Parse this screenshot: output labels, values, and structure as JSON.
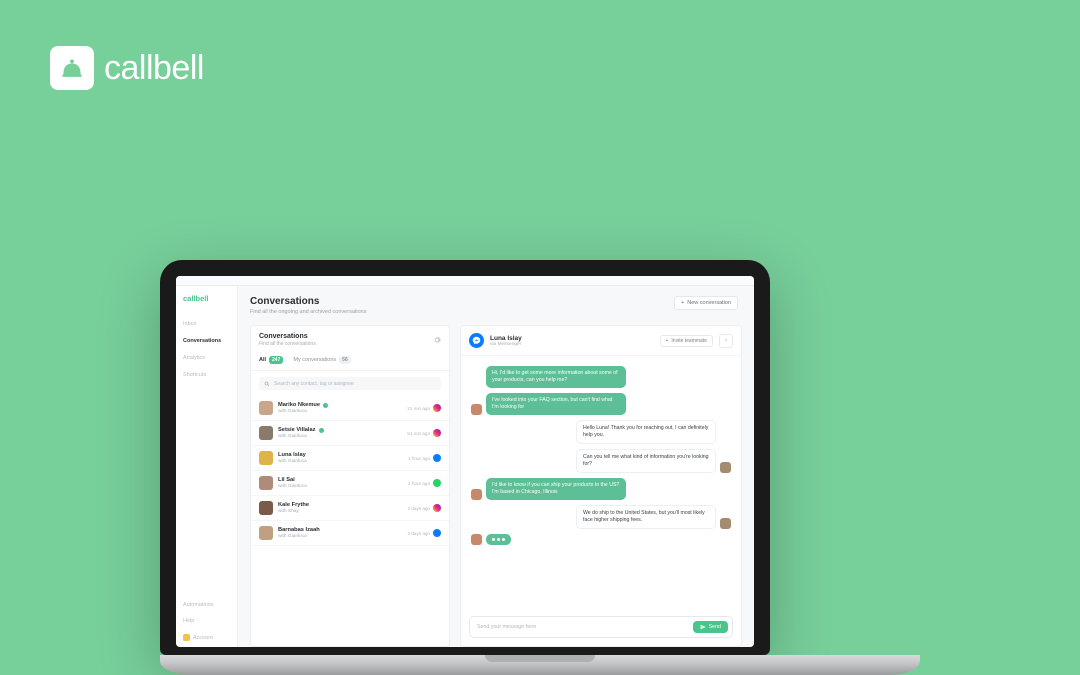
{
  "brand": "callbell",
  "nav": {
    "logo": "callbell",
    "items": [
      "Inbox",
      "Conversations",
      "Analytics",
      "Shortcuts"
    ],
    "active_index": 1,
    "bottom": [
      "Automations",
      "Help",
      "Account"
    ]
  },
  "header": {
    "title": "Conversations",
    "subtitle": "Find all the ongoing and archived conversations",
    "new_btn": "New conversation"
  },
  "list": {
    "title": "Conversations",
    "subtitle": "Find all the conversations",
    "tab_all": "All",
    "tab_all_count": "247",
    "tab_my": "My conversations",
    "tab_my_count": "56",
    "search_placeholder": "Search any contact, tag or assignee",
    "items": [
      {
        "name": "Mariko Nkemue",
        "with": "with Gianluca",
        "ts": "21 min ago",
        "src": "ig",
        "unread": true,
        "avatar": "#c9a58b"
      },
      {
        "name": "Setsie Villalaz",
        "with": "with Gianluca",
        "ts": "51 min ago",
        "src": "ig",
        "unread": true,
        "avatar": "#8a7a6a"
      },
      {
        "name": "Luna Islay",
        "with": "with Gianluca",
        "ts": "1 hour ago",
        "src": "fb",
        "unread": false,
        "avatar": "#e0b24a"
      },
      {
        "name": "Lil Sai",
        "with": "with Gianluca",
        "ts": "2 hour ago",
        "src": "wa",
        "unread": false,
        "avatar": "#b08b7a"
      },
      {
        "name": "Kale Frythe",
        "with": "with Shay",
        "ts": "2 days ago",
        "src": "ig",
        "unread": false,
        "avatar": "#7a5a4a"
      },
      {
        "name": "Barnabas Izaah",
        "with": "with Gianluca",
        "ts": "2 days ago",
        "src": "fb",
        "unread": false,
        "avatar": "#c0a080"
      }
    ]
  },
  "chat": {
    "user_name": "Luna Islay",
    "user_sub": "via Messenger",
    "invite_label": "Invite teammate",
    "messages": [
      {
        "side": "in",
        "text": "Hi, I'd like to get some more information about some of your products, can you help me?"
      },
      {
        "side": "in",
        "text": "I've looked into your FAQ section, but can't find what I'm looking for"
      },
      {
        "side": "out",
        "text": "Hello Luna! Thank you for reaching out, I can definitely help you."
      },
      {
        "side": "out",
        "text": "Can you tell me what kind of information you're looking for?"
      },
      {
        "side": "in",
        "text": "I'd like to know if you can ship your products to the US? I'm based in Chicago, Illinois"
      },
      {
        "side": "out",
        "text": "We do ship to the United States, but you'll most likely face higher shipping fees."
      }
    ],
    "composer_placeholder": "Send your message here",
    "send_label": "Send"
  },
  "colors": {
    "in_avatar": "#c9886a",
    "out_avatar": "#a48c6c"
  }
}
